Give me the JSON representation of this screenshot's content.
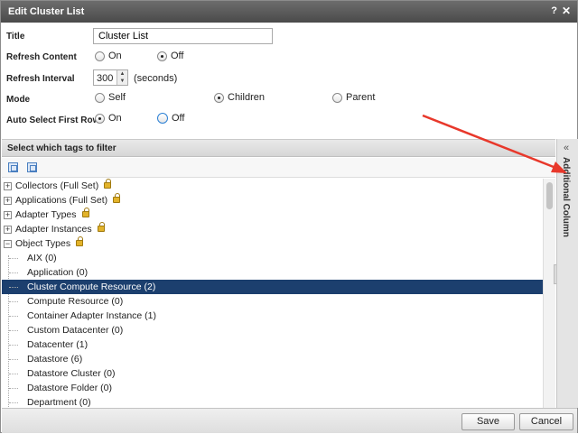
{
  "window": {
    "title": "Edit Cluster List",
    "help": "?",
    "close": "✕"
  },
  "form": {
    "title_label": "Title",
    "title_value": "Cluster List",
    "refresh_content_label": "Refresh Content",
    "refresh_content_on": "On",
    "refresh_content_off": "Off",
    "refresh_content_selected": "Off",
    "refresh_interval_label": "Refresh Interval",
    "refresh_interval_value": "300",
    "refresh_interval_unit": "(seconds)",
    "mode_label": "Mode",
    "mode_self": "Self",
    "mode_children": "Children",
    "mode_parent": "Parent",
    "mode_selected": "Children",
    "auto_select_label": "Auto Select First Row",
    "auto_select_on": "On",
    "auto_select_off": "Off",
    "auto_select_selected": "On"
  },
  "tags": {
    "header": "Select which tags to filter",
    "tree": [
      {
        "label": "Collectors (Full Set)",
        "level": 0,
        "expander": "+",
        "locked": true
      },
      {
        "label": "Applications (Full Set)",
        "level": 0,
        "expander": "+",
        "locked": true
      },
      {
        "label": "Adapter Types",
        "level": 0,
        "expander": "+",
        "locked": true
      },
      {
        "label": "Adapter Instances",
        "level": 0,
        "expander": "+",
        "locked": true
      },
      {
        "label": "Object Types",
        "level": 0,
        "expander": "−",
        "locked": true
      },
      {
        "label": "AIX (0)",
        "level": 1
      },
      {
        "label": "Application (0)",
        "level": 1
      },
      {
        "label": "Cluster Compute Resource (2)",
        "level": 1,
        "selected": true
      },
      {
        "label": "Compute Resource (0)",
        "level": 1
      },
      {
        "label": "Container Adapter Instance (1)",
        "level": 1
      },
      {
        "label": "Custom Datacenter (0)",
        "level": 1
      },
      {
        "label": "Datacenter (1)",
        "level": 1
      },
      {
        "label": "Datastore (6)",
        "level": 1
      },
      {
        "label": "Datastore Cluster (0)",
        "level": 1
      },
      {
        "label": "Datastore Folder (0)",
        "level": 1
      },
      {
        "label": "Department (0)",
        "level": 1
      }
    ]
  },
  "side_panel": {
    "chevron": "«",
    "label": "Additional Column"
  },
  "footer": {
    "save": "Save",
    "cancel": "Cancel"
  },
  "colors": {
    "selection": "#1c3f6e",
    "annotation_arrow": "#e8382b",
    "titlebar": "#555555"
  }
}
